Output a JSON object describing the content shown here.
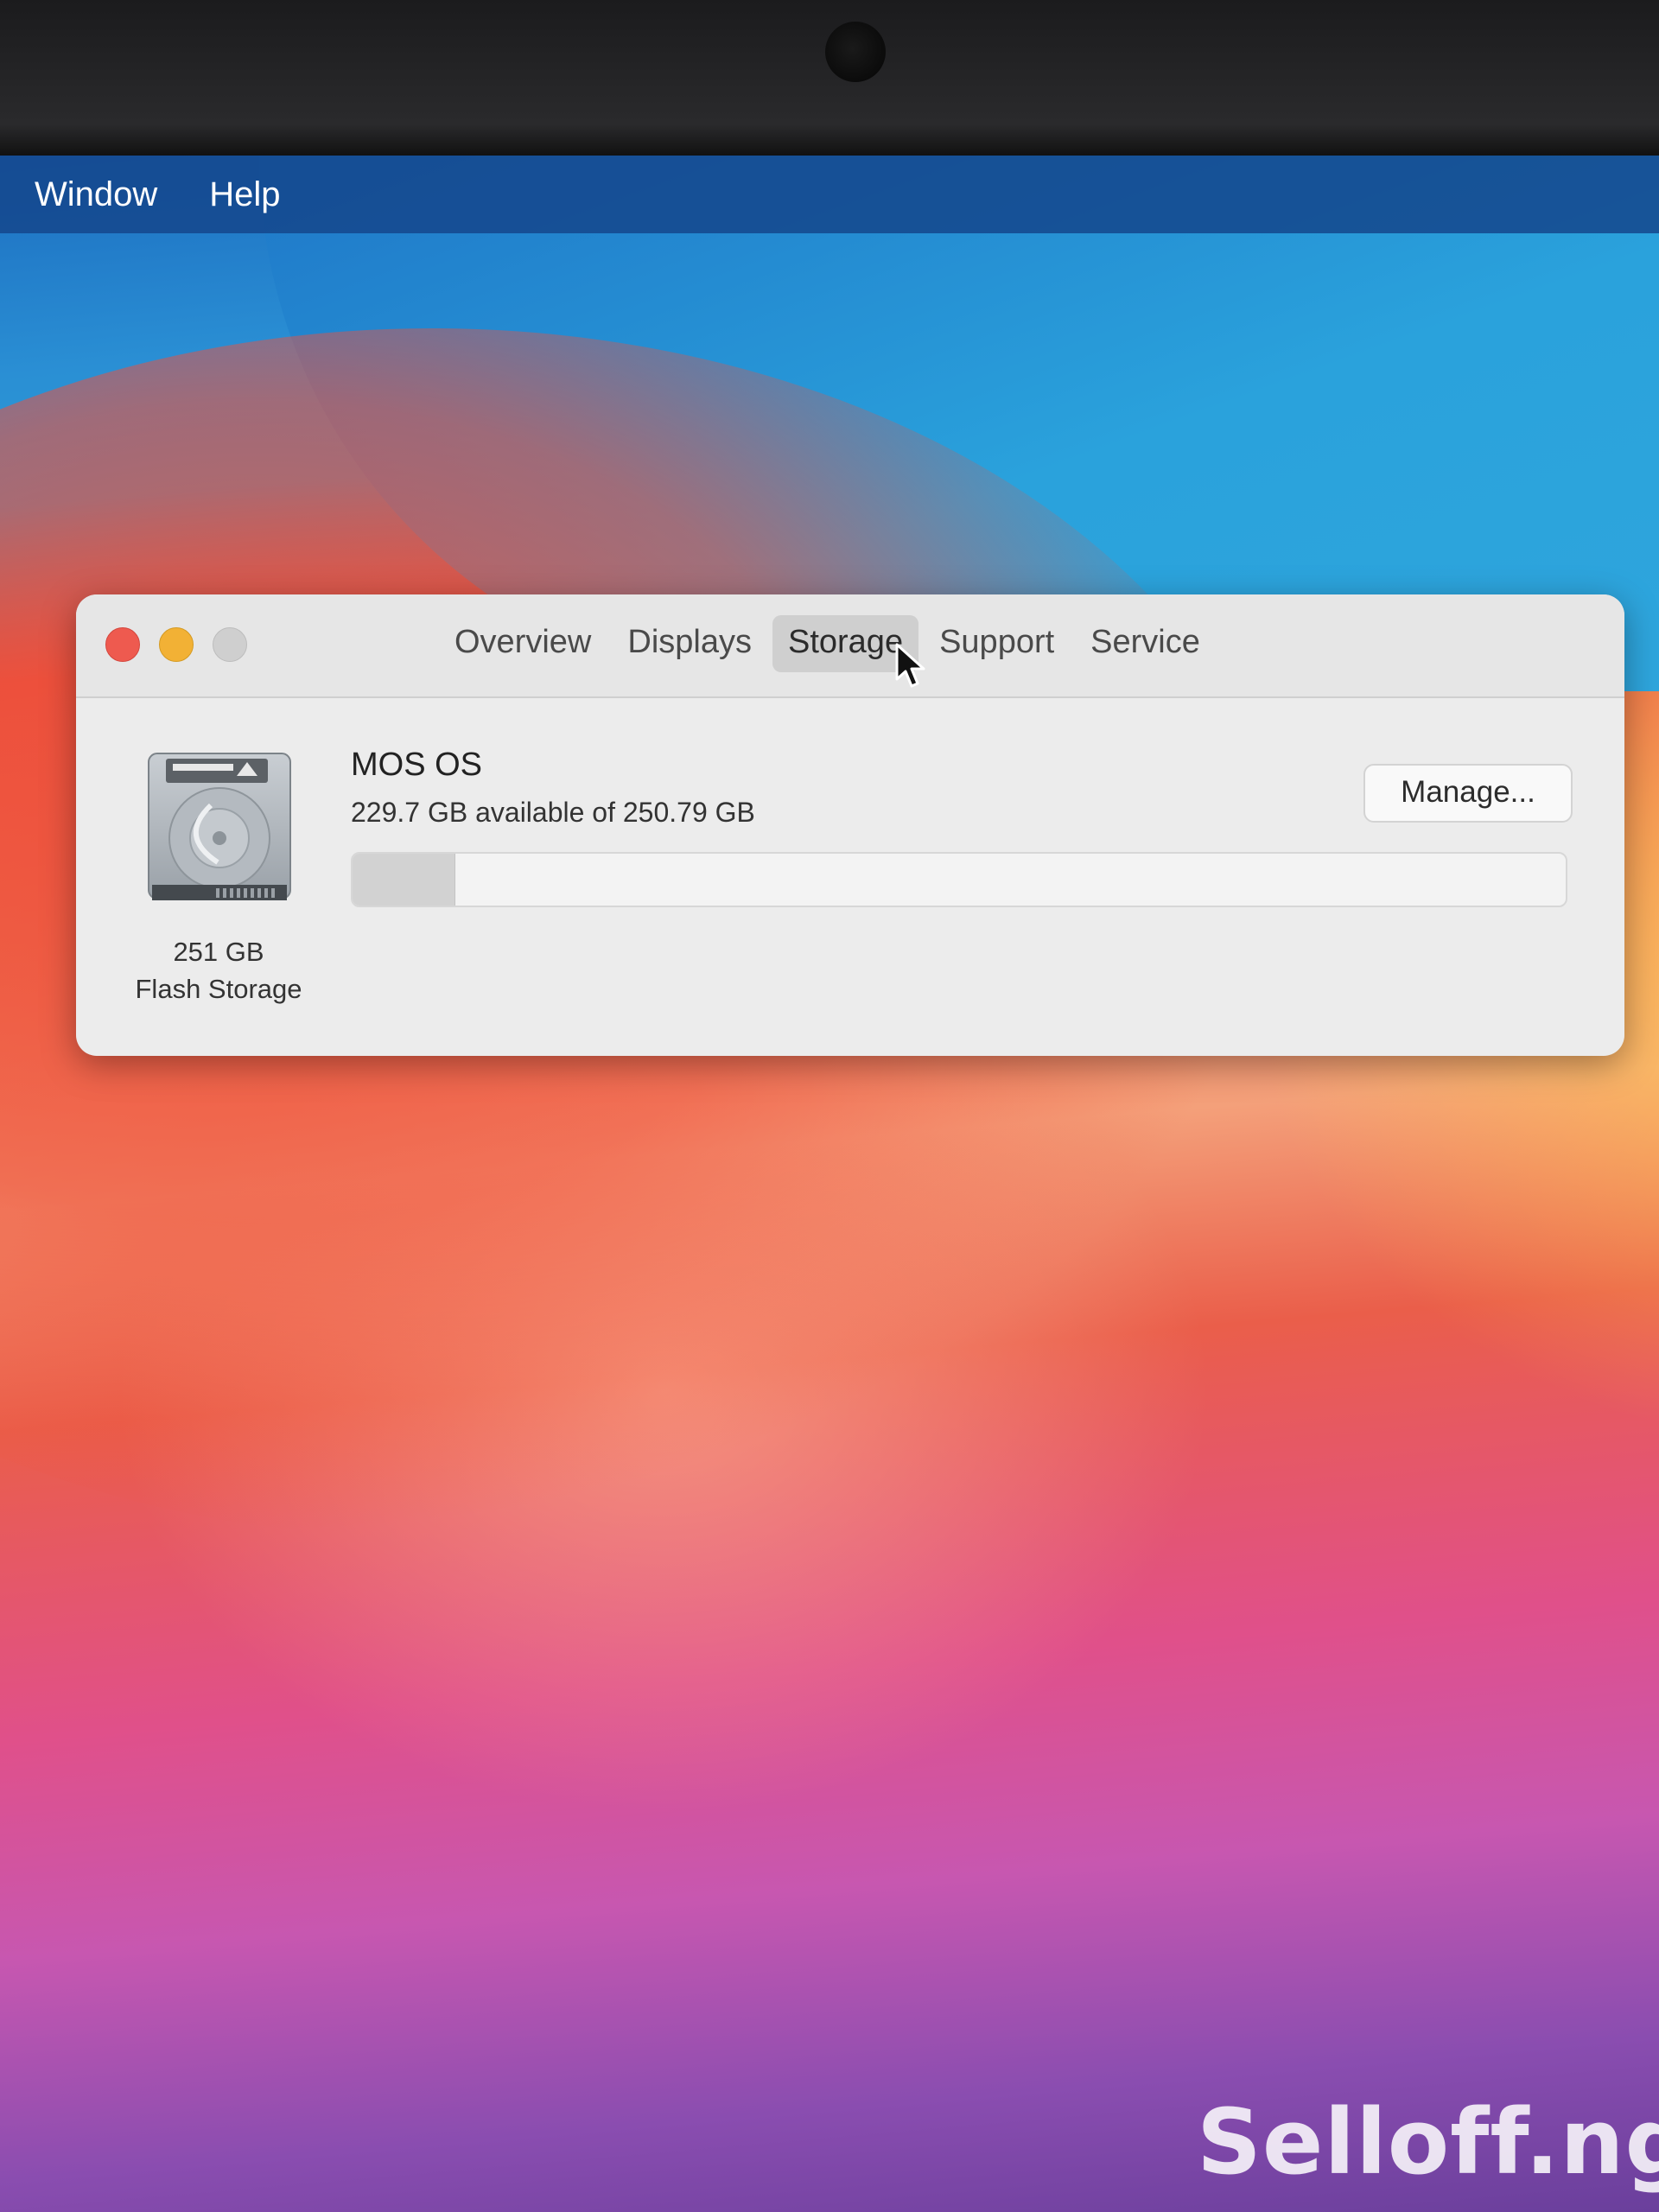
{
  "menubar": {
    "items": [
      "Window",
      "Help"
    ]
  },
  "window": {
    "tabs": [
      {
        "label": "Overview",
        "active": false
      },
      {
        "label": "Displays",
        "active": false
      },
      {
        "label": "Storage",
        "active": true
      },
      {
        "label": "Support",
        "active": false
      },
      {
        "label": "Service",
        "active": false
      }
    ],
    "drive": {
      "capacity": "251 GB",
      "type": "Flash Storage",
      "icon": "hard-drive-icon"
    },
    "volume": {
      "name": "MOS OS",
      "available_text": "229.7 GB available of 250.79 GB",
      "used_fraction": 0.084
    },
    "manage_label": "Manage..."
  },
  "watermark": "Selloff.ng",
  "colors": {
    "close": "#ee5a4f",
    "minimize": "#f2b135",
    "zoom_disabled": "#cfcfcf",
    "tab_active_bg": "#cfcfcf"
  }
}
